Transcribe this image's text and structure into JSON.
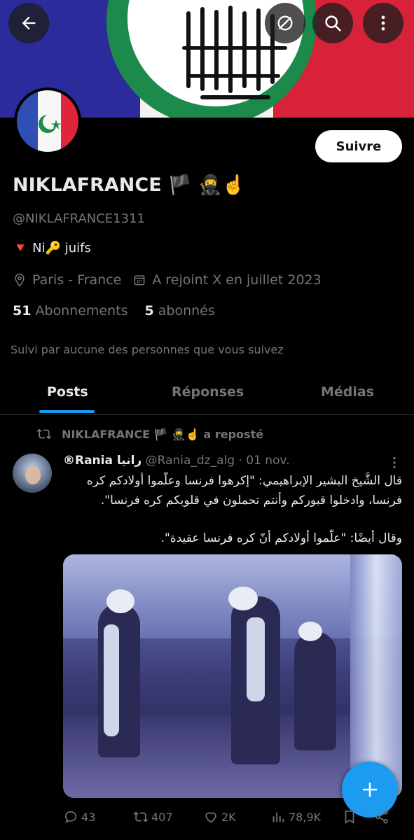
{
  "header": {
    "back_icon": "arrow-left-icon",
    "grok_icon": "slash-circle-icon",
    "search_icon": "search-icon",
    "more_icon": "more-vertical-icon"
  },
  "profile": {
    "display_name": "NIKLAFRANCE 🏴 🥷☝️",
    "handle": "@NIKLAFRANCE1311",
    "bio": "🔻 Ni🔑 juifs",
    "location": "Paris - France",
    "joined": "A rejoint X en juillet 2023",
    "following_count": "51",
    "following_label": "Abonnements",
    "followers_count": "5",
    "followers_label": "abonnés",
    "followed_by": "Suivi par aucune des personnes que vous suivez",
    "follow_button": "Suivre"
  },
  "tabs": [
    {
      "label": "Posts",
      "active": true
    },
    {
      "label": "Réponses",
      "active": false
    },
    {
      "label": "Médias",
      "active": false
    }
  ],
  "post": {
    "repost_label": "NIKLAFRANCE 🏴 🥷☝️ a reposté",
    "author_name": "®Rania رانيا",
    "author_handle": "@Rania_dz_alg",
    "date": "· 01 nov.",
    "text_line1": "قال الشَّيخ البشير الإبراهيمي: \"إكرهوا فرنسا وعلّموا أولادكم كره",
    "text_line2": "فرنسا، وادخلوا قبوركم وأنتم تحملون في قلوبكم كره فرنسا\".",
    "text_line3": "وقال أيضًا: \"علّموا أولادكم أنّ كره فرنسا عقيدة\".",
    "stats": {
      "replies": "43",
      "reposts": "407",
      "likes": "2K",
      "views": "78,9K"
    }
  },
  "colors": {
    "accent": "#1d9bf0",
    "background": "#000000",
    "muted": "#71767b"
  }
}
